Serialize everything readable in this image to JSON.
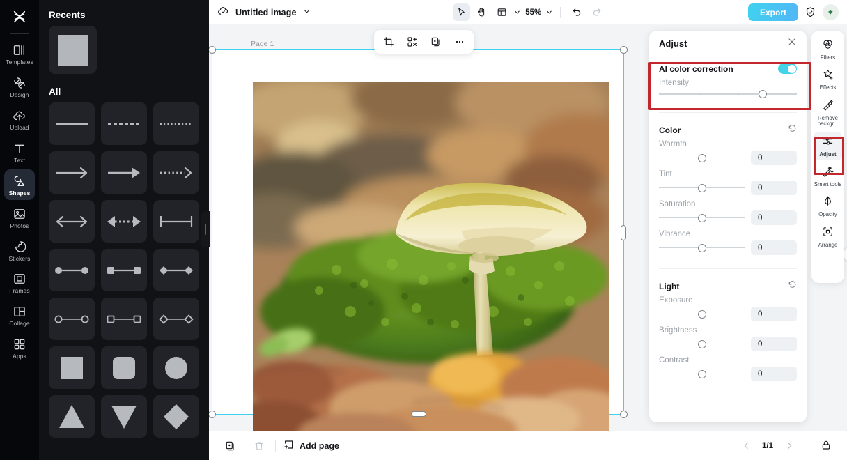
{
  "app": {
    "logo_icon": "capcut-logo-icon"
  },
  "left_rail": {
    "items": [
      {
        "label": "Templates",
        "icon": "templates-icon",
        "active": false
      },
      {
        "label": "Design",
        "icon": "design-icon",
        "active": false
      },
      {
        "label": "Upload",
        "icon": "upload-cloud-icon",
        "active": false
      },
      {
        "label": "Text",
        "icon": "text-icon",
        "active": false
      },
      {
        "label": "Shapes",
        "icon": "shapes-icon",
        "active": true
      },
      {
        "label": "Photos",
        "icon": "photos-icon",
        "active": false
      },
      {
        "label": "Stickers",
        "icon": "stickers-icon",
        "active": false
      },
      {
        "label": "Frames",
        "icon": "frames-icon",
        "active": false
      },
      {
        "label": "Collage",
        "icon": "collage-icon",
        "active": false
      },
      {
        "label": "Apps",
        "icon": "apps-grid-icon",
        "active": false
      }
    ]
  },
  "shapes_panel": {
    "recents_title": "Recents",
    "all_title": "All",
    "recent_items": [
      {
        "name": "square-shape"
      }
    ],
    "all_items": [
      {
        "name": "line-solid-shape"
      },
      {
        "name": "line-dashed-shape"
      },
      {
        "name": "line-dotted-shape"
      },
      {
        "name": "arrow-open-shape"
      },
      {
        "name": "arrow-filled-shape"
      },
      {
        "name": "arrow-dotted-shape"
      },
      {
        "name": "double-arrow-shape"
      },
      {
        "name": "double-arrow-dotted-shape"
      },
      {
        "name": "line-bar-ends-shape"
      },
      {
        "name": "line-circle-ends-filled-shape"
      },
      {
        "name": "line-square-ends-filled-shape"
      },
      {
        "name": "line-diamond-ends-filled-shape"
      },
      {
        "name": "line-circle-ends-outline-shape"
      },
      {
        "name": "line-square-ends-outline-shape"
      },
      {
        "name": "line-diamond-ends-outline-shape"
      },
      {
        "name": "square-filled-shape"
      },
      {
        "name": "rounded-square-shape"
      },
      {
        "name": "circle-shape"
      },
      {
        "name": "triangle-up-shape"
      },
      {
        "name": "triangle-down-shape"
      },
      {
        "name": "diamond-shape"
      }
    ]
  },
  "topbar": {
    "cloud_icon": "cloud-saved-icon",
    "doc_title": "Untitled image",
    "title_chevron": "chevron-down-icon",
    "tools": [
      {
        "name": "select-tool",
        "icon": "cursor-arrow-icon",
        "selected": true
      },
      {
        "name": "hand-tool",
        "icon": "hand-icon",
        "selected": false
      },
      {
        "name": "layout-tool",
        "icon": "layout-panel-icon",
        "selected": false
      }
    ],
    "layout_chevron": "chevron-down-icon",
    "zoom_level": "55%",
    "zoom_chevron": "chevron-down-icon",
    "undo_icon": "undo-arrow-icon",
    "redo_icon": "redo-arrow-icon",
    "export_label": "Export",
    "shield_icon": "shield-check-icon",
    "avatar_icon": "user-avatar-icon"
  },
  "canvas": {
    "page_label": "Page 1",
    "duplicate_page_icon": "duplicate-page-icon",
    "rotate_icon": "rotate-handle-icon",
    "float_toolbar": [
      {
        "name": "crop-button",
        "icon": "crop-icon"
      },
      {
        "name": "cutout-button",
        "icon": "smart-cutout-icon"
      },
      {
        "name": "duplicate-button",
        "icon": "duplicate-icon"
      },
      {
        "name": "more-options-button",
        "icon": "ellipsis-icon"
      }
    ],
    "image_alt": "mushroom-on-moss-photo"
  },
  "adjust_panel": {
    "title": "Adjust",
    "close_icon": "close-x-icon",
    "ai_section": {
      "label": "AI color correction",
      "toggle_on": true,
      "intensity_label": "Intensity",
      "intensity_percent": 75
    },
    "color_section": {
      "title": "Color",
      "reset_icon": "reset-circular-arrow-icon",
      "sliders": [
        {
          "label": "Warmth",
          "value": "0",
          "percent": 50
        },
        {
          "label": "Tint",
          "value": "0",
          "percent": 50
        },
        {
          "label": "Saturation",
          "value": "0",
          "percent": 50
        },
        {
          "label": "Vibrance",
          "value": "0",
          "percent": 50
        }
      ]
    },
    "light_section": {
      "title": "Light",
      "reset_icon": "reset-circular-arrow-icon",
      "sliders": [
        {
          "label": "Exposure",
          "value": "0",
          "percent": 50
        },
        {
          "label": "Brightness",
          "value": "0",
          "percent": 50
        },
        {
          "label": "Contrast",
          "value": "0",
          "percent": 50
        }
      ]
    }
  },
  "right_rail": {
    "items": [
      {
        "label": "Filters",
        "icon": "filters-icon",
        "active": false
      },
      {
        "label": "Effects",
        "icon": "effects-star-icon",
        "active": false
      },
      {
        "label": "Remove\nbackgr...",
        "icon": "remove-background-icon",
        "active": false
      },
      {
        "label": "Adjust",
        "icon": "adjust-sliders-icon",
        "active": true
      },
      {
        "label": "Smart\ntools",
        "icon": "smart-tools-wand-icon",
        "active": false
      },
      {
        "label": "Opacity",
        "icon": "opacity-droplet-icon",
        "active": false
      },
      {
        "label": "Arrange",
        "icon": "arrange-icon",
        "active": false
      }
    ]
  },
  "bottombar": {
    "duplicate_page_icon": "duplicate-page-icon",
    "delete_page_icon": "trash-icon",
    "add_page_icon": "add-page-icon",
    "add_page_label": "Add page",
    "prev_icon": "chevron-left-icon",
    "page_indicator": "1/1",
    "next_icon": "chevron-right-icon",
    "present_icon": "present-icon"
  },
  "annotations": {
    "accent_color": "#c1272d",
    "boxes": [
      {
        "name": "ai-color-correction-highlight"
      },
      {
        "name": "adjust-tool-highlight"
      }
    ]
  },
  "colors": {
    "export_gradient_start": "#3fd2ef",
    "export_gradient_end": "#52b6f6",
    "toggle_on": "#43d3e8",
    "selection_border": "#3fd0f0",
    "annotation_red": "#c1272d",
    "rail_bg": "#06070a",
    "panel_bg": "#111215"
  }
}
